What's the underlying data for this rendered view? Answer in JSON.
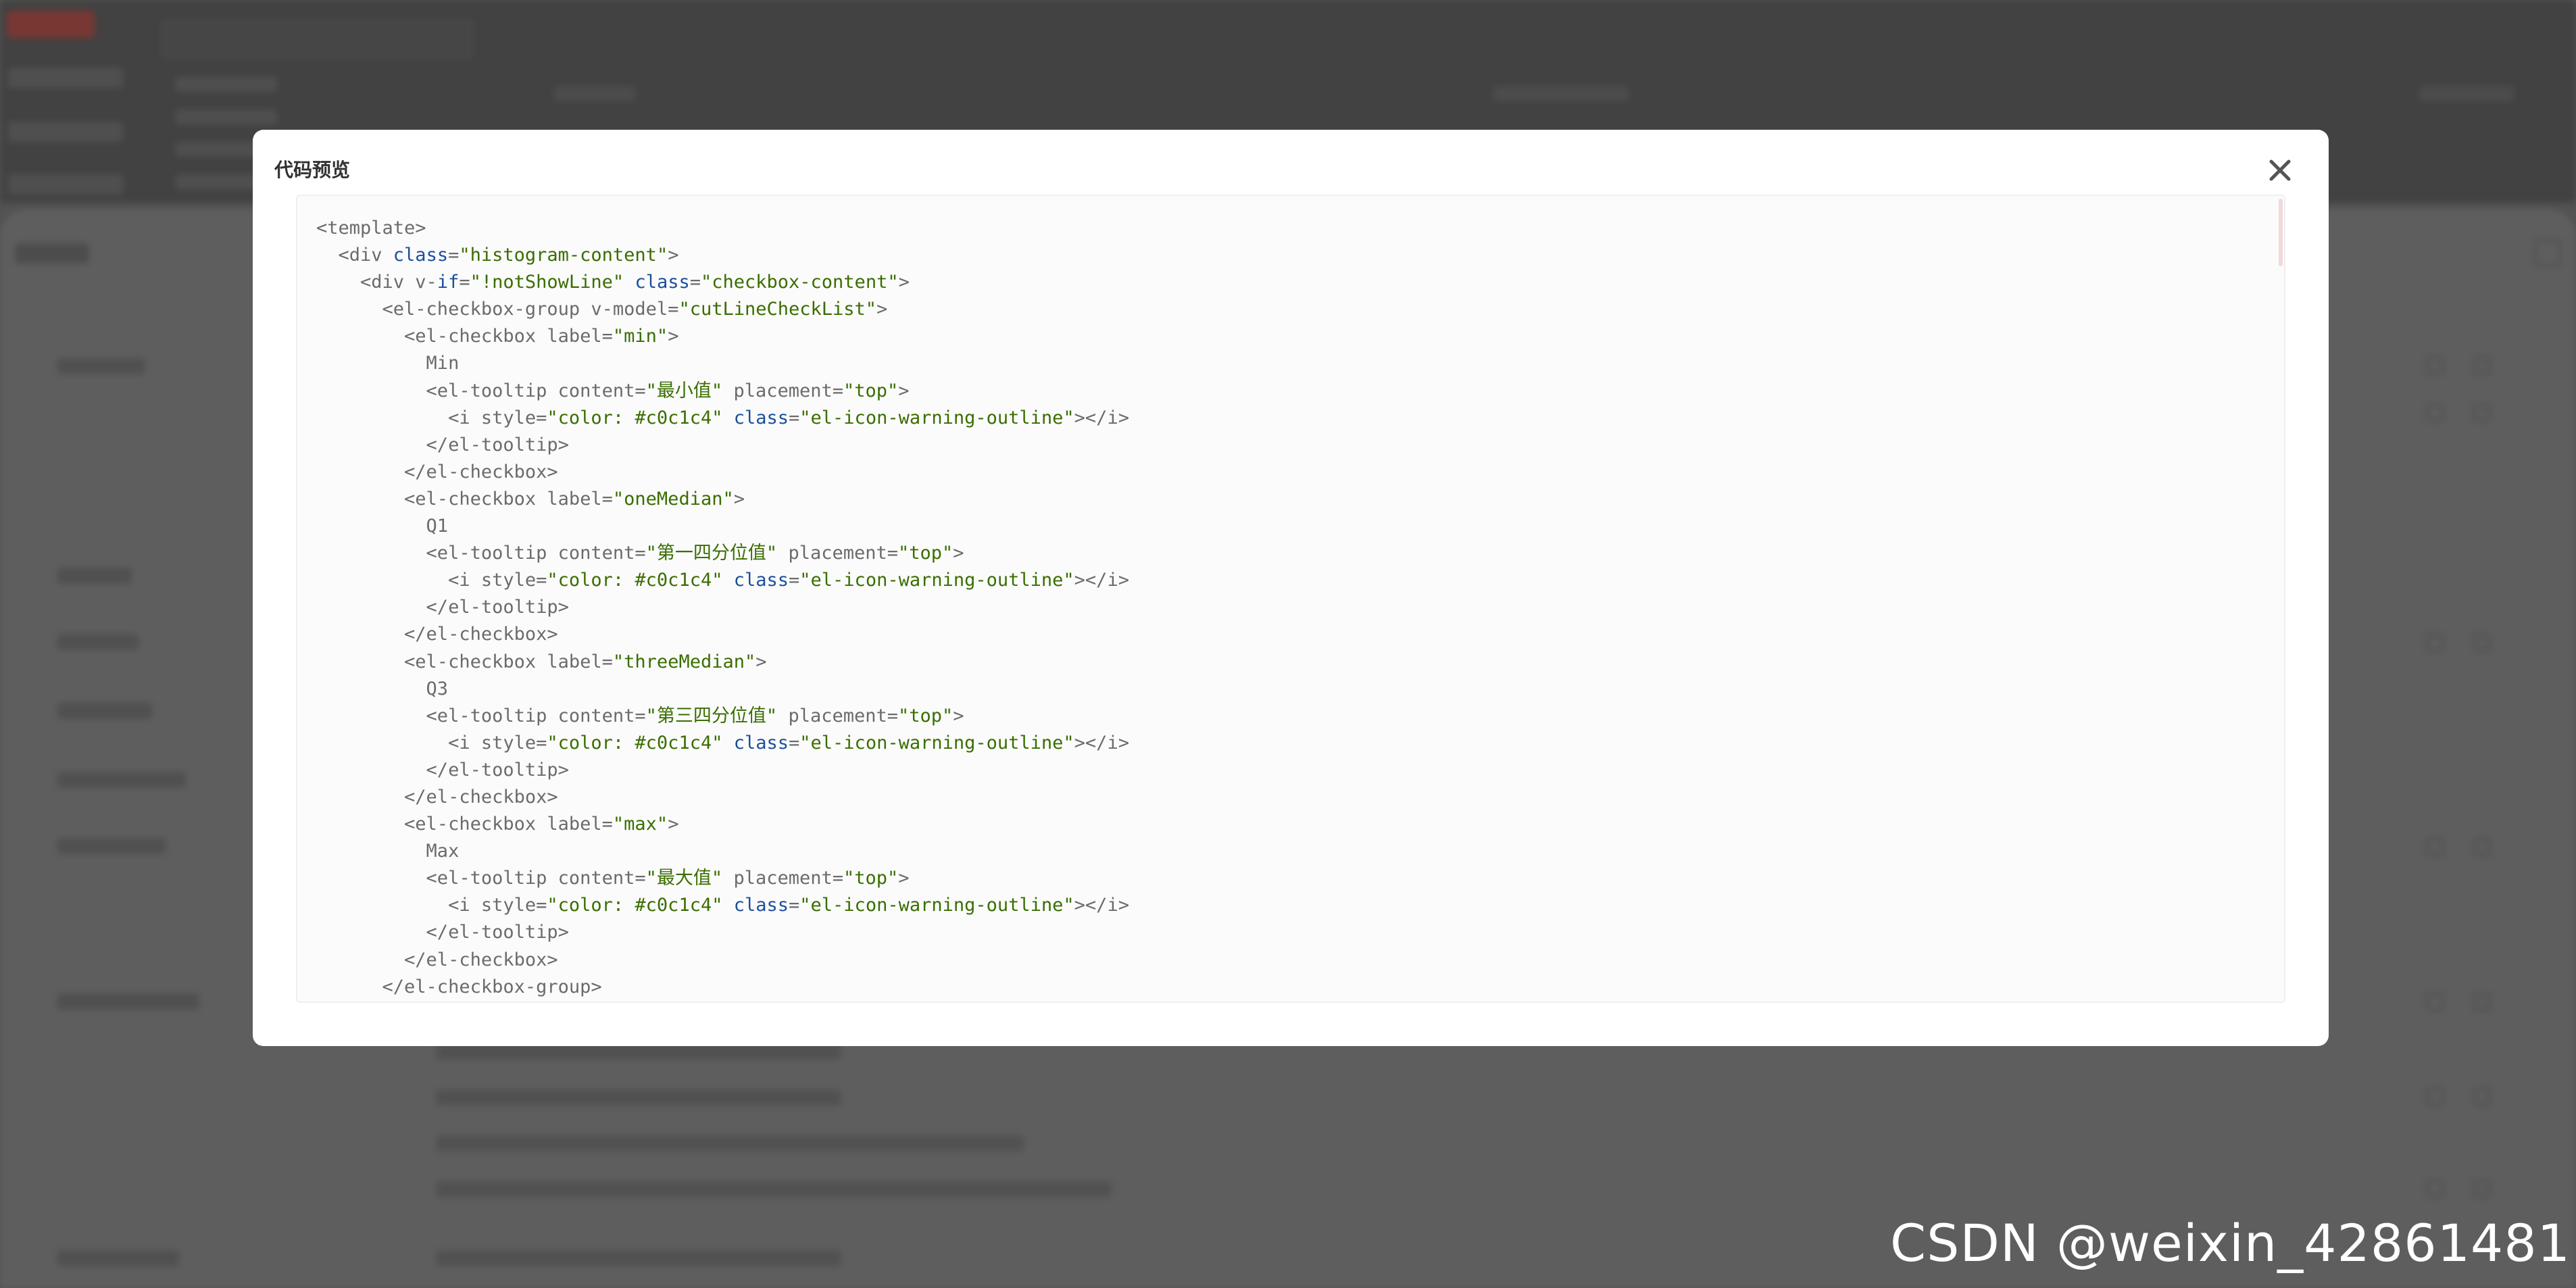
{
  "dialog": {
    "title": "代码预览"
  },
  "code_lines": [
    [
      [
        "t",
        "<template>"
      ]
    ],
    [
      [
        "t",
        "  <div "
      ],
      [
        "a",
        "class"
      ],
      [
        "t",
        "="
      ],
      [
        "s",
        "\"histogram-content\""
      ],
      [
        "t",
        ">"
      ]
    ],
    [
      [
        "t",
        "    <div v-"
      ],
      [
        "a",
        "if"
      ],
      [
        "t",
        "="
      ],
      [
        "s",
        "\"!notShowLine\""
      ],
      [
        "t",
        " "
      ],
      [
        "a",
        "class"
      ],
      [
        "t",
        "="
      ],
      [
        "s",
        "\"checkbox-content\""
      ],
      [
        "t",
        ">"
      ]
    ],
    [
      [
        "t",
        "      <el-checkbox-group v-model="
      ],
      [
        "s",
        "\"cutLineCheckList\""
      ],
      [
        "t",
        ">"
      ]
    ],
    [
      [
        "t",
        "        <el-checkbox label="
      ],
      [
        "s",
        "\"min\""
      ],
      [
        "t",
        ">"
      ]
    ],
    [
      [
        "t",
        "          Min"
      ]
    ],
    [
      [
        "t",
        "          <el-tooltip content="
      ],
      [
        "s",
        "\"最小值\""
      ],
      [
        "t",
        " placement="
      ],
      [
        "s",
        "\"top\""
      ],
      [
        "t",
        ">"
      ]
    ],
    [
      [
        "t",
        "            <i style="
      ],
      [
        "s",
        "\"color: #c0c1c4\""
      ],
      [
        "t",
        " "
      ],
      [
        "a",
        "class"
      ],
      [
        "t",
        "="
      ],
      [
        "s",
        "\"el-icon-warning-outline\""
      ],
      [
        "t",
        "></i>"
      ]
    ],
    [
      [
        "t",
        "          </el-tooltip>"
      ]
    ],
    [
      [
        "t",
        "        </el-checkbox>"
      ]
    ],
    [
      [
        "t",
        "        <el-checkbox label="
      ],
      [
        "s",
        "\"oneMedian\""
      ],
      [
        "t",
        ">"
      ]
    ],
    [
      [
        "t",
        "          Q1"
      ]
    ],
    [
      [
        "t",
        "          <el-tooltip content="
      ],
      [
        "s",
        "\"第一四分位值\""
      ],
      [
        "t",
        " placement="
      ],
      [
        "s",
        "\"top\""
      ],
      [
        "t",
        ">"
      ]
    ],
    [
      [
        "t",
        "            <i style="
      ],
      [
        "s",
        "\"color: #c0c1c4\""
      ],
      [
        "t",
        " "
      ],
      [
        "a",
        "class"
      ],
      [
        "t",
        "="
      ],
      [
        "s",
        "\"el-icon-warning-outline\""
      ],
      [
        "t",
        "></i>"
      ]
    ],
    [
      [
        "t",
        "          </el-tooltip>"
      ]
    ],
    [
      [
        "t",
        "        </el-checkbox>"
      ]
    ],
    [
      [
        "t",
        "        <el-checkbox label="
      ],
      [
        "s",
        "\"threeMedian\""
      ],
      [
        "t",
        ">"
      ]
    ],
    [
      [
        "t",
        "          Q3"
      ]
    ],
    [
      [
        "t",
        "          <el-tooltip content="
      ],
      [
        "s",
        "\"第三四分位值\""
      ],
      [
        "t",
        " placement="
      ],
      [
        "s",
        "\"top\""
      ],
      [
        "t",
        ">"
      ]
    ],
    [
      [
        "t",
        "            <i style="
      ],
      [
        "s",
        "\"color: #c0c1c4\""
      ],
      [
        "t",
        " "
      ],
      [
        "a",
        "class"
      ],
      [
        "t",
        "="
      ],
      [
        "s",
        "\"el-icon-warning-outline\""
      ],
      [
        "t",
        "></i>"
      ]
    ],
    [
      [
        "t",
        "          </el-tooltip>"
      ]
    ],
    [
      [
        "t",
        "        </el-checkbox>"
      ]
    ],
    [
      [
        "t",
        "        <el-checkbox label="
      ],
      [
        "s",
        "\"max\""
      ],
      [
        "t",
        ">"
      ]
    ],
    [
      [
        "t",
        "          Max"
      ]
    ],
    [
      [
        "t",
        "          <el-tooltip content="
      ],
      [
        "s",
        "\"最大值\""
      ],
      [
        "t",
        " placement="
      ],
      [
        "s",
        "\"top\""
      ],
      [
        "t",
        ">"
      ]
    ],
    [
      [
        "t",
        "            <i style="
      ],
      [
        "s",
        "\"color: #c0c1c4\""
      ],
      [
        "t",
        " "
      ],
      [
        "a",
        "class"
      ],
      [
        "t",
        "="
      ],
      [
        "s",
        "\"el-icon-warning-outline\""
      ],
      [
        "t",
        "></i>"
      ]
    ],
    [
      [
        "t",
        "          </el-tooltip>"
      ]
    ],
    [
      [
        "t",
        "        </el-checkbox>"
      ]
    ],
    [
      [
        "t",
        "      </el-checkbox-group>"
      ]
    ]
  ],
  "watermark": "CSDN @weixin_42861481",
  "icons": {
    "close": "close-icon"
  },
  "colors": {
    "attr": "#1c4f9c",
    "string": "#3a6e00",
    "plain": "#6b6b6b"
  }
}
